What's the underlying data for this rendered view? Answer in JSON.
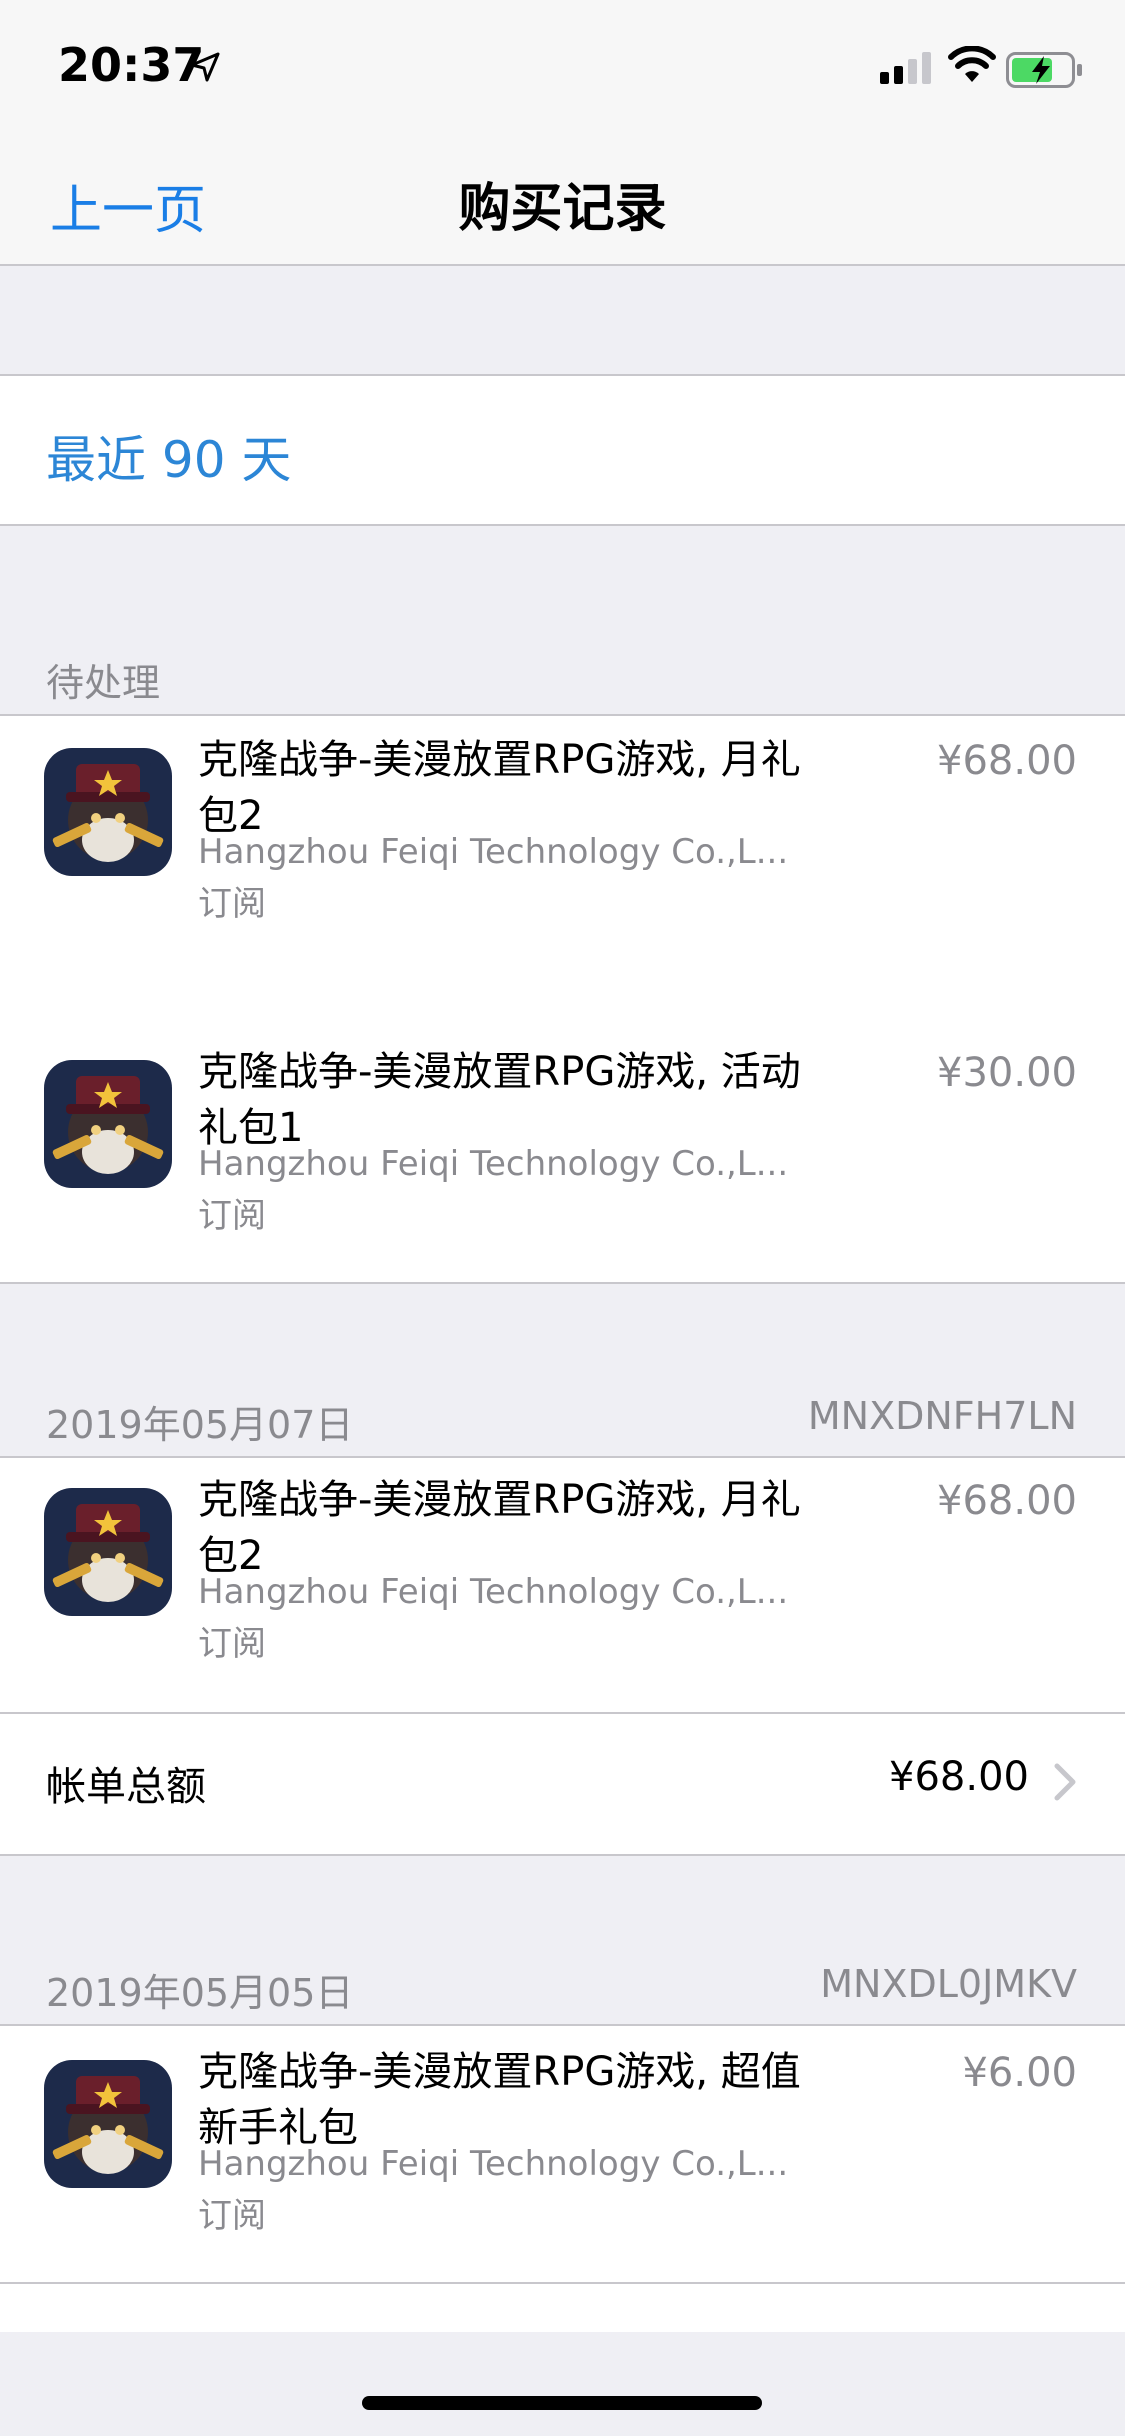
{
  "status": {
    "time": "20:37"
  },
  "nav": {
    "back_label": "上一页",
    "title": "购买记录"
  },
  "filter": {
    "label": "最近 90 天"
  },
  "sections": [
    {
      "header_left": "待处理",
      "header_right": ""
    },
    {
      "header_left": "2019年05月07日",
      "header_right": "MNXDNFH7LN"
    },
    {
      "header_left": "2019年05月05日",
      "header_right": "MNXDL0JMKV"
    }
  ],
  "items": [
    {
      "title": "克隆战争-美漫放置RPG游戏, 月礼包2",
      "developer": "Hangzhou Feiqi Technology Co.,L...",
      "type": "订阅",
      "price": "¥68.00"
    },
    {
      "title": "克隆战争-美漫放置RPG游戏, 活动礼包1",
      "developer": "Hangzhou Feiqi Technology Co.,L...",
      "type": "订阅",
      "price": "¥30.00"
    },
    {
      "title": "克隆战争-美漫放置RPG游戏, 月礼包2",
      "developer": "Hangzhou Feiqi Technology Co.,L...",
      "type": "订阅",
      "price": "¥68.00"
    },
    {
      "title": "克隆战争-美漫放置RPG游戏, 超值新手礼包",
      "developer": "Hangzhou Feiqi Technology Co.,L...",
      "type": "订阅",
      "price": "¥6.00"
    }
  ],
  "totals": [
    {
      "label": "帐单总额",
      "value": "¥68.00"
    }
  ],
  "colors": {
    "accent": "#1a7ee6",
    "secondary_text": "#8a8a8f",
    "background": "#efeff4"
  }
}
